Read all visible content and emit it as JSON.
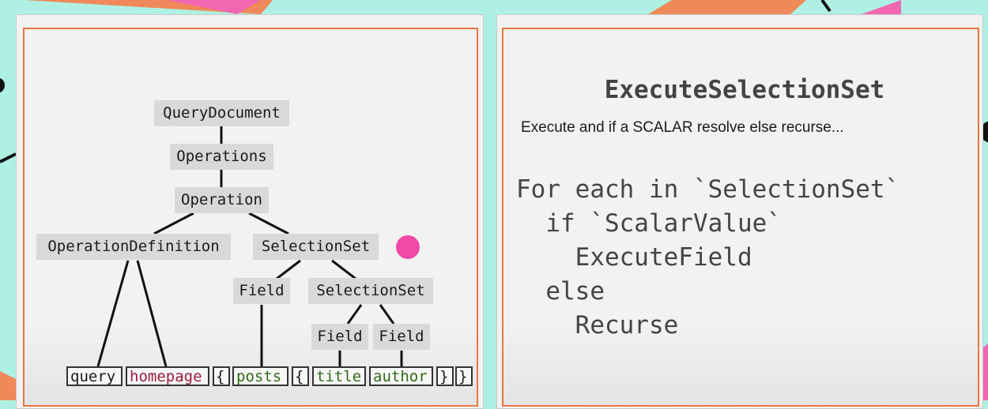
{
  "tree": {
    "nodes": {
      "query_document": "QueryDocument",
      "operations": "Operations",
      "operation": "Operation",
      "operation_definition": "OperationDefinition",
      "selection_set_1": "SelectionSet",
      "field_1": "Field",
      "selection_set_2": "SelectionSet",
      "field_2": "Field",
      "field_3": "Field"
    },
    "tokens": {
      "query": "query",
      "homepage": "homepage",
      "brace_open_1": "{",
      "posts": "posts",
      "brace_open_2": "{",
      "title": "title",
      "author": "author",
      "brace_close_1": "}",
      "brace_close_2": "}"
    }
  },
  "slide": {
    "title": "ExecuteSelectionSet",
    "subtitle": "Execute and if a SCALAR resolve else recurse...",
    "code": [
      "For each in `SelectionSet`",
      "  if `ScalarValue`",
      "    ExecuteField",
      "  else",
      "    Recurse"
    ]
  },
  "colors": {
    "background": "#aef1e4",
    "frame": "#e8773f",
    "accent_dot": "#ef4aa5",
    "name_token": "#9b1b3c",
    "field_token": "#2f6b16"
  }
}
